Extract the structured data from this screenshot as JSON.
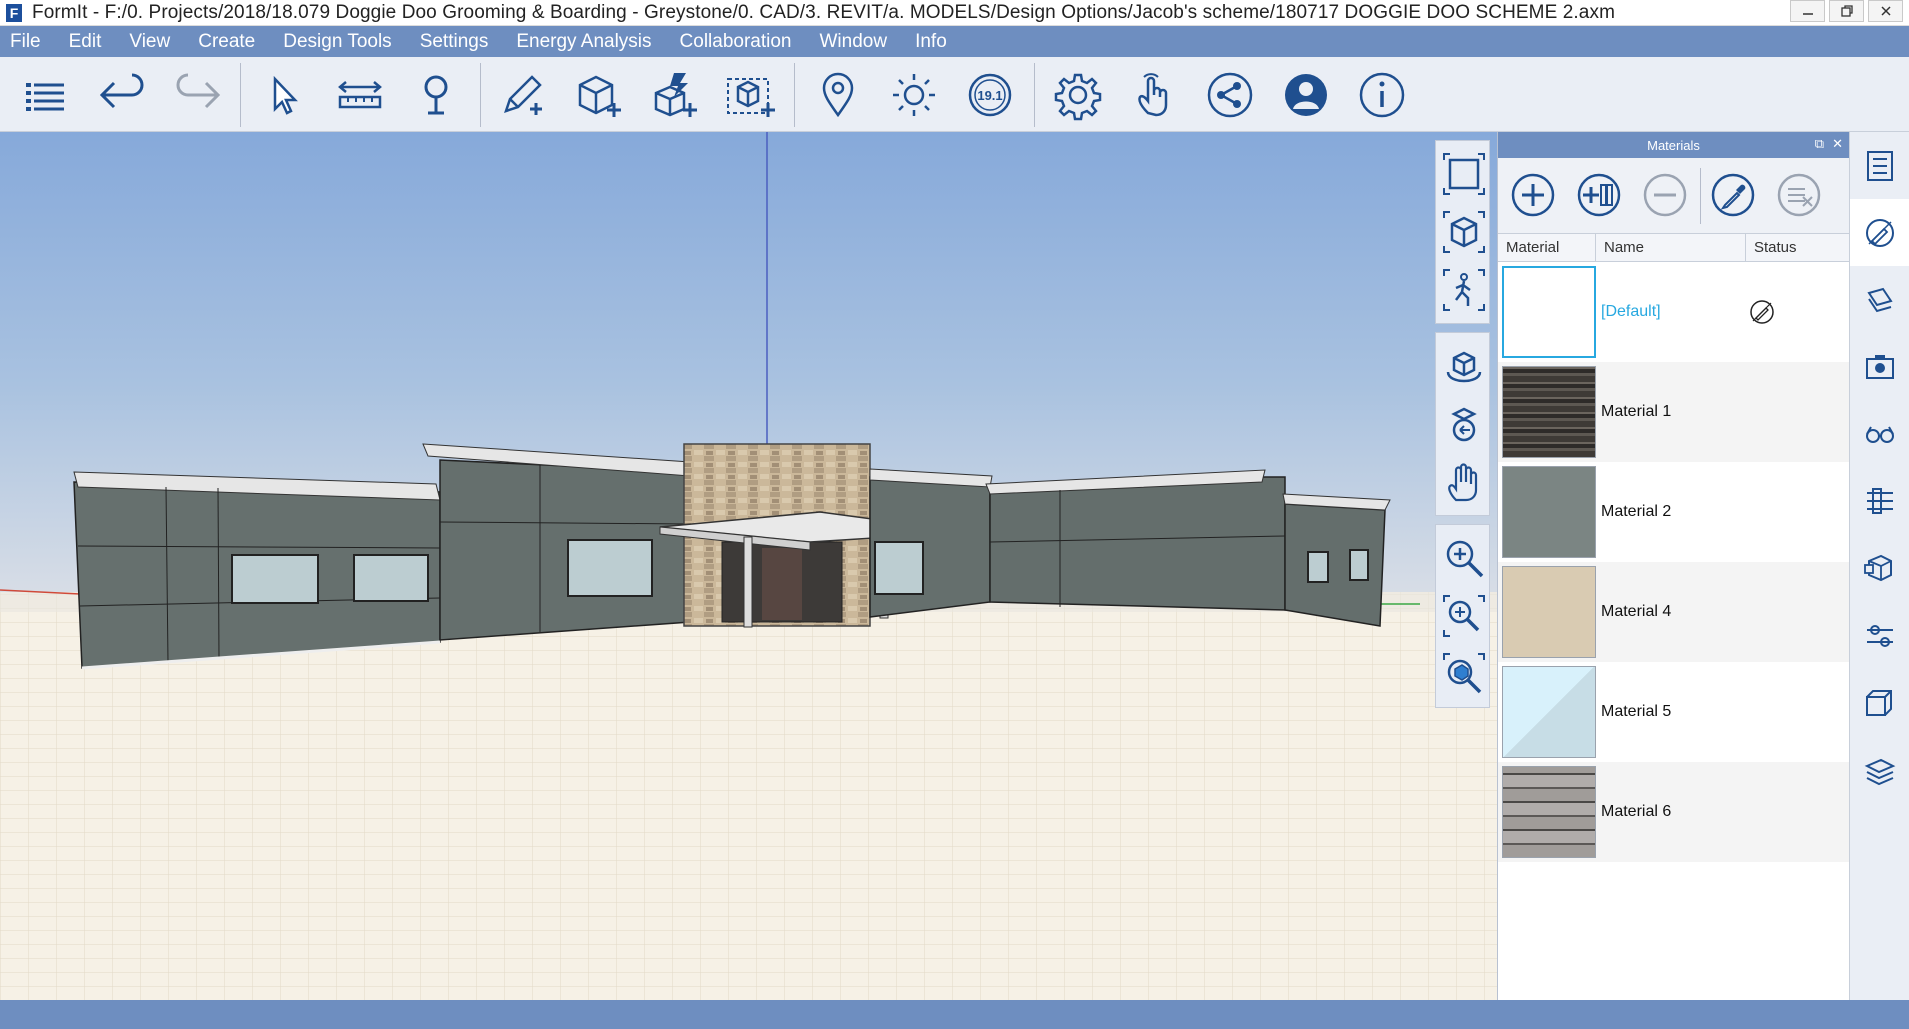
{
  "window": {
    "title": "FormIt - F:/0. Projects/2018/18.079 Doggie Doo Grooming & Boarding - Greystone/0. CAD/3. REVIT/a. MODELS/Design Options/Jacob's scheme/180717 DOGGIE DOO SCHEME 2.axm",
    "logo_letter": "F"
  },
  "menu": [
    "File",
    "Edit",
    "View",
    "Create",
    "Design Tools",
    "Settings",
    "Energy Analysis",
    "Collaboration",
    "Window",
    "Info"
  ],
  "toolbar": {
    "tools": [
      "menu-icon",
      "undo-icon",
      "redo-icon",
      "select-icon",
      "measure-icon",
      "level-pin-icon",
      "sketch-pencil-icon",
      "add-cube-icon",
      "add-solid-icon",
      "add-group-icon",
      "location-icon",
      "sun-icon",
      "version-badge",
      "settings-gear-icon",
      "touch-hand-icon",
      "share-icon",
      "user-icon",
      "info-icon"
    ],
    "version_label": "19.1"
  },
  "navbar": {
    "groups": [
      [
        "frame-icon",
        "cube-view-icon",
        "walk-icon"
      ],
      [
        "orbit-icon",
        "look-around-icon",
        "pan-hand-icon"
      ],
      [
        "zoom-in-icon",
        "zoom-region-icon",
        "zoom-fit-icon"
      ]
    ]
  },
  "materials_panel": {
    "title": "Materials",
    "columns": [
      "Material",
      "Name",
      "Status"
    ],
    "rows": [
      {
        "name": "[Default]",
        "is_default": true,
        "swatch": "#ffffff"
      },
      {
        "name": "Material 1",
        "is_default": false,
        "swatch": "#4a4540"
      },
      {
        "name": "Material 2",
        "is_default": false,
        "swatch": "#7b8583"
      },
      {
        "name": "Material 4",
        "is_default": false,
        "swatch": "#d9cbb2"
      },
      {
        "name": "Material 5",
        "is_default": false,
        "swatch": "#d8f1fb"
      },
      {
        "name": "Material 6",
        "is_default": false,
        "swatch": "#9b9795"
      }
    ]
  },
  "right_sidebar": [
    "properties-icon",
    "materials-icon",
    "layers-icon",
    "scenes-icon",
    "visual-styles-icon",
    "levels-icon",
    "groups-icon",
    "dynamo-icon",
    "layers-stack-icon",
    "grid-icon"
  ],
  "colors": {
    "accent": "#6e8ec0",
    "sky_top": "#84a8d9",
    "ground": "#f6f1e6",
    "wall": "#6a7472"
  }
}
